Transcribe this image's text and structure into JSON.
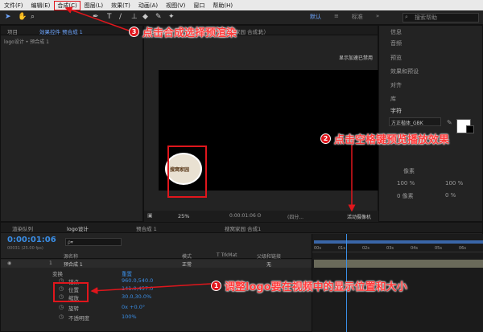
{
  "menu": {
    "items": [
      "文件(F)",
      "编辑(E)",
      "合成(C)",
      "图层(L)",
      "效果(T)",
      "动画(A)",
      "视图(V)",
      "窗口",
      "帮助(H)"
    ],
    "highlighted_index": 2
  },
  "workspace": {
    "tabs": [
      "默认",
      "≡",
      "标准",
      "»"
    ],
    "active_index": 0,
    "search_placeholder": "搜索帮助"
  },
  "project_panel": {
    "tab_project": "项目",
    "tab_effects": "效果控件 预合成 1",
    "breadcrumb": "logo设计 • 预合成 1"
  },
  "comp_panel": {
    "tabs": [
      "logo设计",
      "预合成 1",
      "搜窝家园 合成1"
    ],
    "header_suffix": "先）",
    "gpu_text": "显示加速已禁用",
    "zoom": "25%",
    "timecode": "0:00:01:06",
    "quality": "(四分...",
    "camera": "活动摄像机",
    "logo_text": "搜窝家园"
  },
  "right_panel": {
    "items": [
      "信息",
      "音频",
      "预览",
      "效果和预设",
      "对齐",
      "库",
      "字符"
    ],
    "font_name": "方正楷体_GBK",
    "unit_pixels": "像素",
    "percent_1": "100 %",
    "percent_2": "100 %",
    "px_values": [
      "0 像素",
      "0 %"
    ]
  },
  "timeline": {
    "tabs": [
      "渲染队列",
      "logo设计",
      "预合成 1",
      "搜窝家园 合成1"
    ],
    "timecode": "0:00:01:06",
    "timecode_sub": "00031 (25.00 fps)",
    "search_placeholder": "ρ▾",
    "columns": [
      "源名称",
      "模式",
      "T TrkMat",
      "父级和链接"
    ],
    "layer": {
      "index": "1",
      "name": "预合成 1",
      "mode": "正常",
      "parent": "无"
    },
    "group_transform": "变换",
    "reset": "重置",
    "properties": [
      {
        "name": "锚点",
        "value": "960.0,540.0"
      },
      {
        "name": "位置",
        "value": "141.0,457.0"
      },
      {
        "name": "缩放",
        "value": "30.0,30.0%"
      },
      {
        "name": "旋转",
        "value": "0x +0.0°"
      },
      {
        "name": "不透明度",
        "value": "100%"
      }
    ],
    "ruler": [
      "00s",
      "01s",
      "02s",
      "03s",
      "04s",
      "05s",
      "06s",
      "07s"
    ]
  },
  "callouts": {
    "c1_num": "1",
    "c1_text": "调整logo要在视频中的显示位置和大小",
    "c2_num": "2",
    "c2_text": "点击空格键预览播放效果",
    "c3_num": "3",
    "c3_text": "点击合成选择预渲染"
  },
  "colors": {
    "accent_red": "#e0161c",
    "value_blue": "#3a8ee6",
    "tab_blue": "#6ea6ff"
  }
}
